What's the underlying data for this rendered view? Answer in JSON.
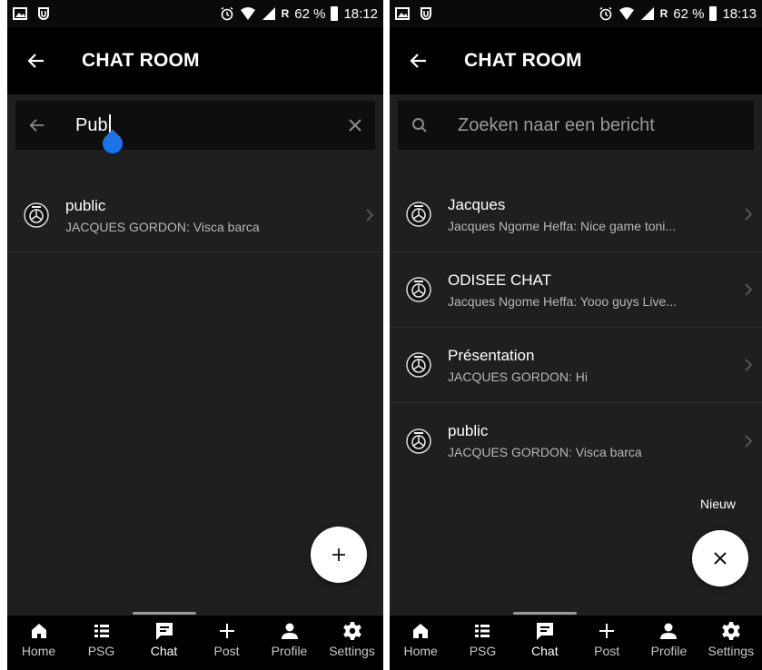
{
  "left": {
    "status": {
      "battery": "62 %",
      "time": "18:12",
      "net": "R"
    },
    "title": "CHAT ROOM",
    "search": {
      "value": "Pub"
    },
    "items": [
      {
        "title": "public",
        "subtitle": "JACQUES GORDON: Visca barca"
      }
    ],
    "fab_icon": "plus-icon"
  },
  "right": {
    "status": {
      "battery": "62 %",
      "time": "18:13",
      "net": "R"
    },
    "title": "CHAT ROOM",
    "search": {
      "placeholder": "Zoeken naar een bericht"
    },
    "items": [
      {
        "title": "Jacques",
        "subtitle": "Jacques Ngome Heffa: Nice game toni..."
      },
      {
        "title": "ODISEE CHAT",
        "subtitle": "Jacques Ngome Heffa: Yooo guys Live..."
      },
      {
        "title": "Présentation",
        "subtitle": "JACQUES GORDON: Hi"
      },
      {
        "title": "public",
        "subtitle": "JACQUES GORDON: Visca barca"
      }
    ],
    "fab_label": "Nieuw",
    "fab_icon": "close-icon"
  },
  "nav": {
    "items": [
      {
        "label": "Home",
        "icon": "home-icon"
      },
      {
        "label": "PSG",
        "icon": "list-icon"
      },
      {
        "label": "Chat",
        "icon": "chat-icon"
      },
      {
        "label": "Post",
        "icon": "plus-icon"
      },
      {
        "label": "Profile",
        "icon": "person-icon"
      },
      {
        "label": "Settings",
        "icon": "gear-icon"
      }
    ],
    "active": "Chat"
  },
  "colors": {
    "background": "#1f1f1f",
    "appbar": "#000000",
    "accent": "#1a73e8",
    "fab": "#ffffff"
  }
}
